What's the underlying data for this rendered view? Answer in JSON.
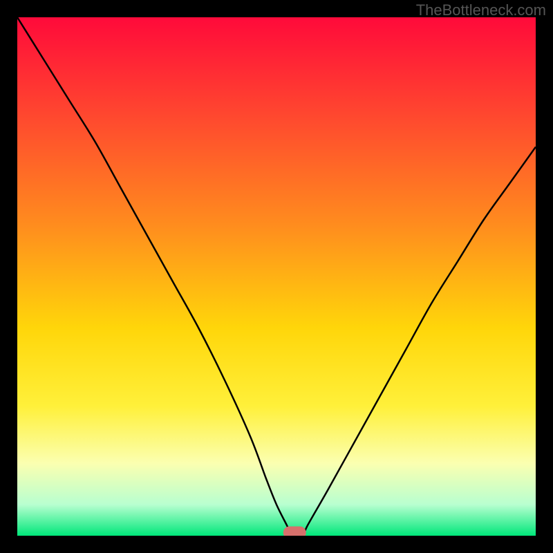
{
  "watermark": "TheBottleneck.com",
  "chart_data": {
    "type": "line",
    "title": "",
    "xlabel": "",
    "ylabel": "",
    "xlim": [
      0,
      100
    ],
    "ylim": [
      0,
      100
    ],
    "gradient_stops": [
      {
        "offset": 0.0,
        "color": "#ff0a3a"
      },
      {
        "offset": 0.2,
        "color": "#ff4b2e"
      },
      {
        "offset": 0.4,
        "color": "#ff8c1e"
      },
      {
        "offset": 0.6,
        "color": "#ffd60a"
      },
      {
        "offset": 0.75,
        "color": "#fff03a"
      },
      {
        "offset": 0.86,
        "color": "#fbffb0"
      },
      {
        "offset": 0.94,
        "color": "#b8ffd0"
      },
      {
        "offset": 1.0,
        "color": "#00e77a"
      }
    ],
    "series": [
      {
        "name": "bottleneck-curve",
        "color": "#000000",
        "width": 2.5,
        "x": [
          0,
          5,
          10,
          15,
          20,
          25,
          30,
          35,
          40,
          45,
          48,
          50,
          52,
          53,
          55,
          56,
          60,
          65,
          70,
          75,
          80,
          85,
          90,
          95,
          100
        ],
        "y": [
          100,
          92,
          84,
          76,
          67,
          58,
          49,
          40,
          30,
          19,
          11,
          6,
          2,
          0,
          0,
          2,
          9,
          18,
          27,
          36,
          45,
          53,
          61,
          68,
          75
        ]
      }
    ],
    "marker": {
      "name": "optimal-point",
      "x": 53.5,
      "y": 0.6,
      "rx": 2.2,
      "ry": 1.2,
      "color": "#d6706c"
    }
  }
}
